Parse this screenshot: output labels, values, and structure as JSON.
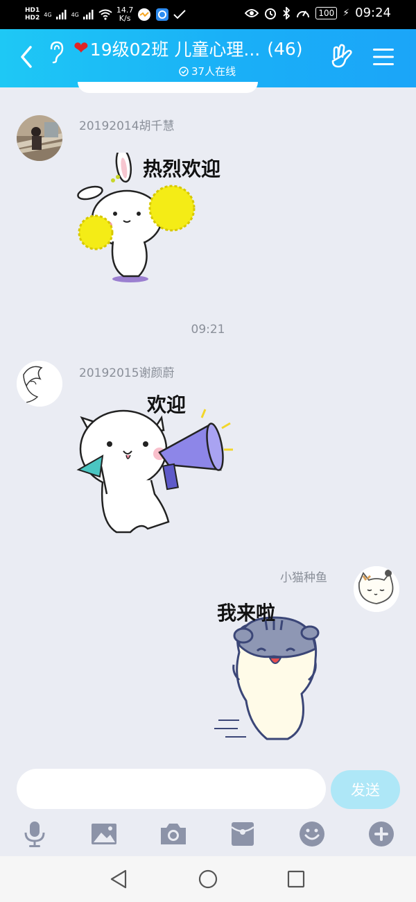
{
  "status_bar": {
    "hd1": "HD1",
    "hd2": "HD2",
    "net1": "4G",
    "net2": "4G",
    "speed_value": "14.7",
    "speed_unit": "K/s",
    "battery": "100",
    "time": "09:24"
  },
  "header": {
    "heart": "❤",
    "title": "19级02班 儿童心理...",
    "member_count": "(46)",
    "online": "37人在线"
  },
  "messages": [
    {
      "sender": "20192014胡千慧",
      "sticker_text": "热烈欢迎"
    },
    {
      "sender": "20192015谢颜蔚",
      "sticker_text": "欢迎"
    },
    {
      "sender": "小猫种鱼",
      "sticker_text": "我来啦"
    }
  ],
  "time_separator": "09:21",
  "input": {
    "value": "",
    "placeholder": ""
  },
  "send_label": "发送",
  "toolbar": {
    "icons": [
      "microphone-icon",
      "image-icon",
      "camera-icon",
      "red-packet-icon",
      "emoji-icon",
      "plus-icon"
    ]
  },
  "colors": {
    "header_start": "#1ec8f5",
    "header_end": "#1ba5f8",
    "background": "#eaecf3",
    "send_button": "#aee7f7",
    "tool_icon": "#8c93a8"
  }
}
